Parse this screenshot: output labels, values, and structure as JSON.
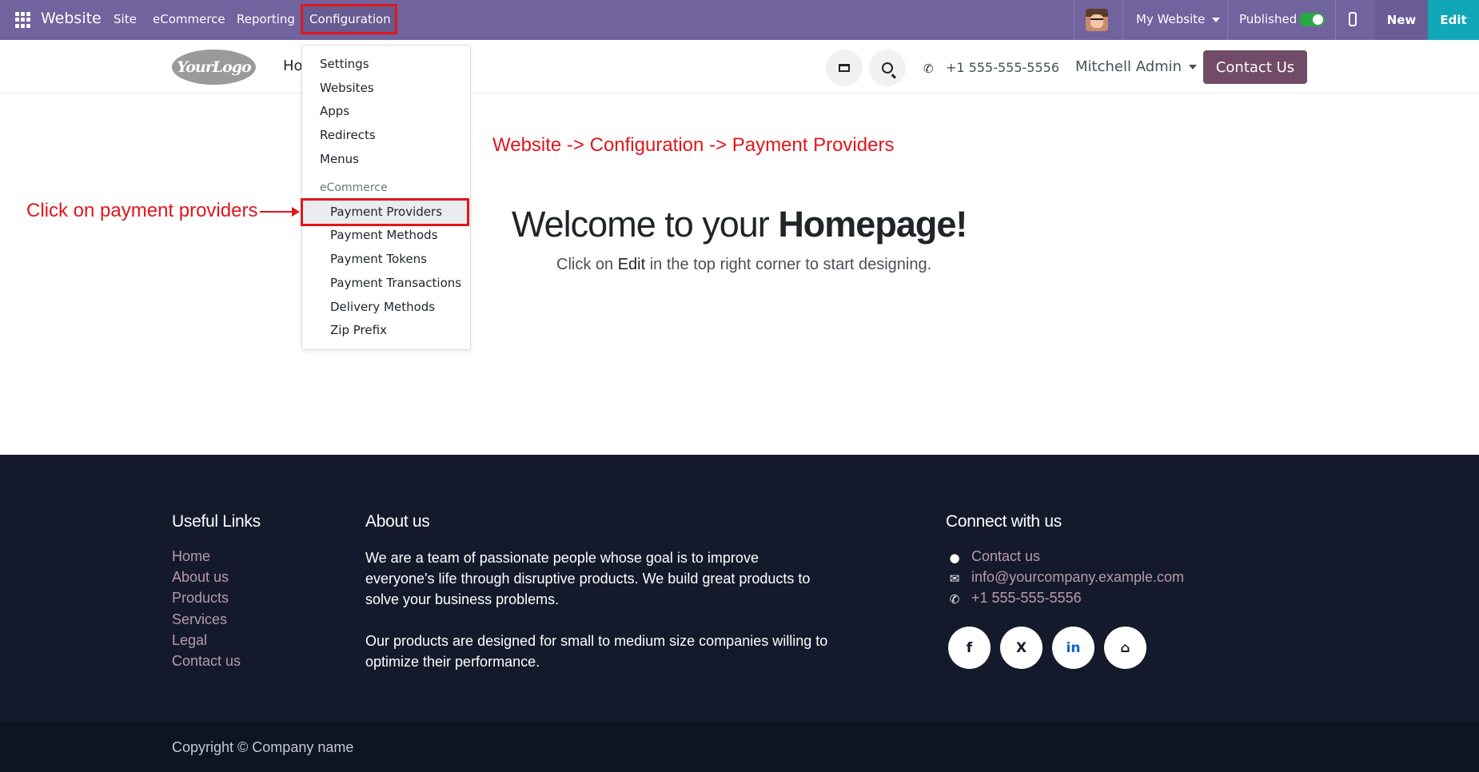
{
  "topbar": {
    "brand": "Website",
    "menu": [
      "Site",
      "eCommerce",
      "Reporting",
      "Configuration"
    ],
    "my_website": "My Website",
    "published": "Published",
    "new_label": "New",
    "edit_label": "Edit"
  },
  "header": {
    "logo_text": "YourLogo",
    "home_truncated": "Ho",
    "phone": "+1 555-555-5556",
    "user": "Mitchell Admin",
    "contact_button": "Contact Us"
  },
  "dropdown": {
    "items": [
      "Settings",
      "Websites",
      "Apps",
      "Redirects",
      "Menus"
    ],
    "section_header": "eCommerce",
    "sub_items": [
      "Payment Providers",
      "Payment Methods",
      "Payment Tokens",
      "Payment Transactions",
      "Delivery Methods",
      "Zip Prefix"
    ]
  },
  "annotations": {
    "path_note": "Website -> Configuration -> Payment Providers",
    "click_note": "Click on payment providers"
  },
  "main": {
    "welcome_prefix": "Welcome to your ",
    "welcome_bold": "Homepage!",
    "sub_prefix": "Click on ",
    "sub_edit": "Edit",
    "sub_suffix": " in the top right corner to start designing."
  },
  "footer": {
    "useful_links_title": "Useful Links",
    "useful_links": [
      "Home",
      "About us",
      "Products",
      "Services",
      "Legal",
      "Contact us"
    ],
    "about_title": "About us",
    "about_p1": "We are a team of passionate people whose goal is to improve everyone's life through disruptive products. We build great products to solve your business problems.",
    "about_p2": "Our products are designed for small to medium size companies willing to optimize their performance.",
    "connect_title": "Connect with us",
    "connect_items": [
      "Contact us",
      "info@yourcompany.example.com",
      "+1 555-555-5556"
    ],
    "social": [
      "f",
      "X",
      "in",
      "⌂"
    ],
    "copyright": "Copyright © Company name"
  },
  "colors": {
    "topbar": "#71639e",
    "edit": "#10a8b8",
    "contact": "#714b67",
    "annotation": "#e0161b",
    "footer": "#141a2b"
  }
}
